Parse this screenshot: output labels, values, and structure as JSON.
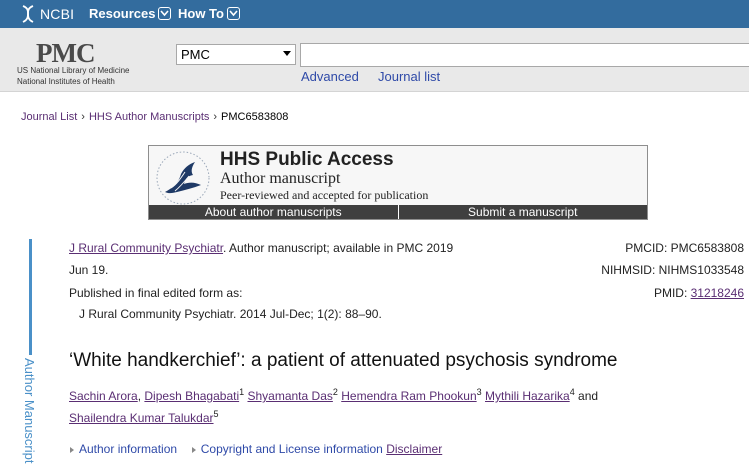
{
  "ncbi_bar": {
    "logo_text": "NCBI",
    "resources_label": "Resources",
    "howto_label": "How To",
    "bg_color": "#336c9e"
  },
  "pmc_header": {
    "logo_text": "PMC",
    "nlm_line1": "US National Library of Medicine",
    "nlm_line2": "National Institutes of Health",
    "db_select_value": "PMC",
    "search_value": "",
    "advanced_label": "Advanced",
    "journal_list_label": "Journal list"
  },
  "breadcrumb": {
    "items": [
      "Journal List",
      "HHS Author Manuscripts",
      "PMC6583808"
    ],
    "sep": "›"
  },
  "hhs_banner": {
    "title": "HHS Public Access",
    "subtitle": "Author manuscript",
    "peer": "Peer-reviewed and accepted for publication",
    "about_label": "About author manuscripts",
    "submit_label": "Submit a manuscript"
  },
  "side_label": "Author Manuscript",
  "citation": {
    "journal": "J Rural Community Psychiatr",
    "line1_rest": ". Author manuscript; available in PMC 2019",
    "line2": "Jun 19.",
    "line3": "Published in final edited form as:",
    "line4": "J Rural Community Psychiatr. 2014 Jul-Dec; 1(2): 88–90."
  },
  "ids": {
    "pmcid": "PMCID: PMC6583808",
    "nihmsid": "NIHMSID: NIHMS1033548",
    "pmid_label": "PMID: ",
    "pmid_value": "31218246"
  },
  "article": {
    "title": "‘White handkerchief’: a patient of attenuated psychosis syndrome"
  },
  "authors": {
    "a1": "Sachin Arora",
    "a2": "Dipesh Bhagabati",
    "a2_sup": "1",
    "a3": "Shyamanta Das",
    "a3_sup": "2",
    "a4": "Hemendra Ram Phookun",
    "a4_sup": "3",
    "a5": "Mythili Hazarika",
    "a5_sup": "4",
    "and": "and",
    "a6": "Shailendra Kumar Talukdar",
    "a6_sup": "5"
  },
  "info_row": {
    "author_info": "Author information",
    "copyright": "Copyright and License information",
    "disclaimer": "Disclaimer"
  }
}
